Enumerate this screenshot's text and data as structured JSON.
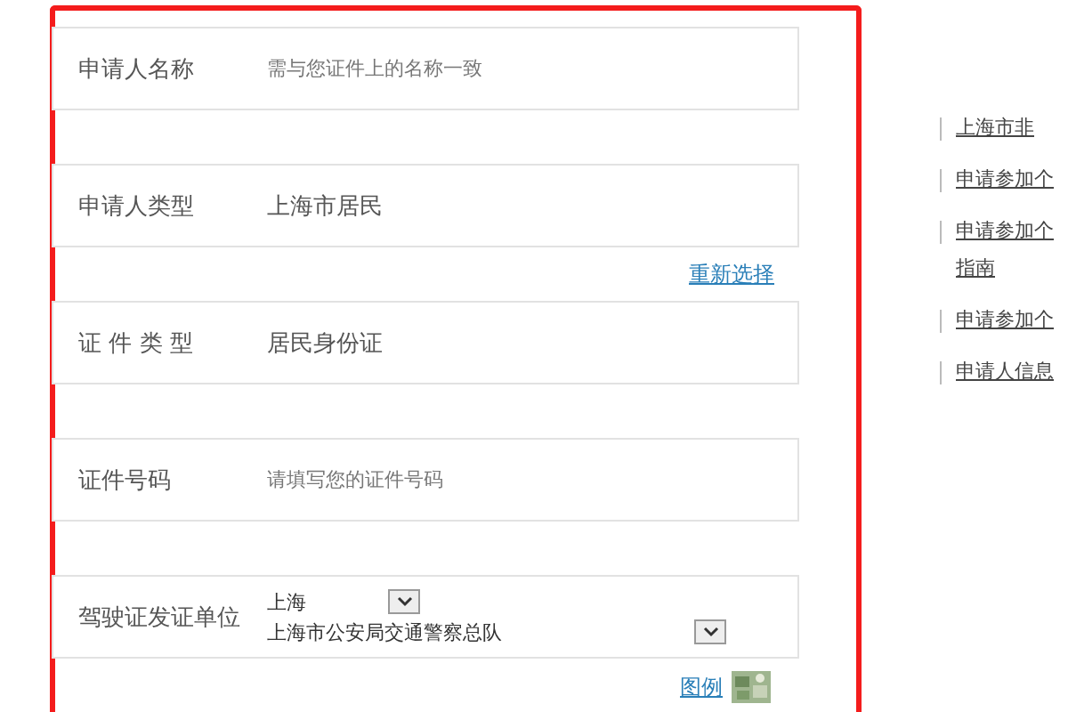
{
  "form": {
    "rows": [
      {
        "kind": "input",
        "label": "申请人名称",
        "placeholder": "需与您证件上的名称一致"
      },
      {
        "kind": "text",
        "label": "申请人类型",
        "value": "上海市居民",
        "link": "重新选择"
      },
      {
        "kind": "text",
        "label": "证 件 类 型",
        "value": "居民身份证"
      },
      {
        "kind": "input",
        "label": "证件号码",
        "placeholder": "请填写您的证件号码"
      },
      {
        "kind": "selects",
        "label": "驾驶证发证单位",
        "selects": [
          "上海",
          "上海市公安局交通警察总队"
        ]
      }
    ],
    "legend": "图例"
  },
  "related_links": [
    {
      "lines": [
        "上海市非"
      ]
    },
    {
      "lines": [
        "申请参加个"
      ]
    },
    {
      "lines": [
        "申请参加个",
        "指南"
      ]
    },
    {
      "lines": [
        "申请参加个"
      ]
    },
    {
      "lines": [
        "申请人信息"
      ]
    }
  ]
}
